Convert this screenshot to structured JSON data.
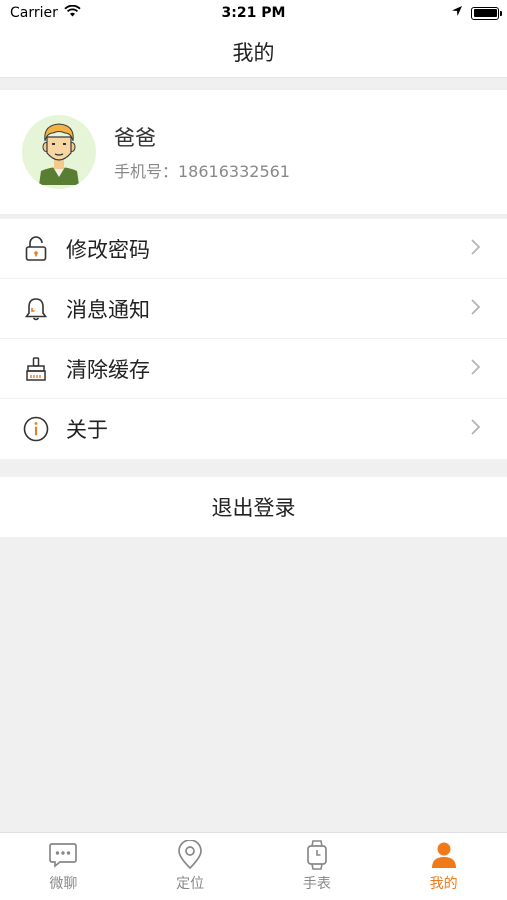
{
  "status_bar": {
    "carrier": "Carrier",
    "time": "3:21 PM"
  },
  "nav": {
    "title": "我的"
  },
  "profile": {
    "name": "爸爸",
    "phone": "手机号：18616332561"
  },
  "menu": {
    "items": [
      {
        "label": "修改密码",
        "icon": "lock-icon"
      },
      {
        "label": "消息通知",
        "icon": "bell-icon"
      },
      {
        "label": "清除缓存",
        "icon": "broom-icon"
      },
      {
        "label": "关于",
        "icon": "info-icon"
      }
    ]
  },
  "logout": {
    "label": "退出登录"
  },
  "tabs": [
    {
      "label": "微聊",
      "icon": "chat-icon",
      "active": false
    },
    {
      "label": "定位",
      "icon": "location-icon",
      "active": false
    },
    {
      "label": "手表",
      "icon": "watch-icon",
      "active": false
    },
    {
      "label": "我的",
      "icon": "person-icon",
      "active": true
    }
  ],
  "colors": {
    "accent": "#f07a1a",
    "background": "#f0f0f0",
    "avatar_bg": "#e6f5d8"
  }
}
